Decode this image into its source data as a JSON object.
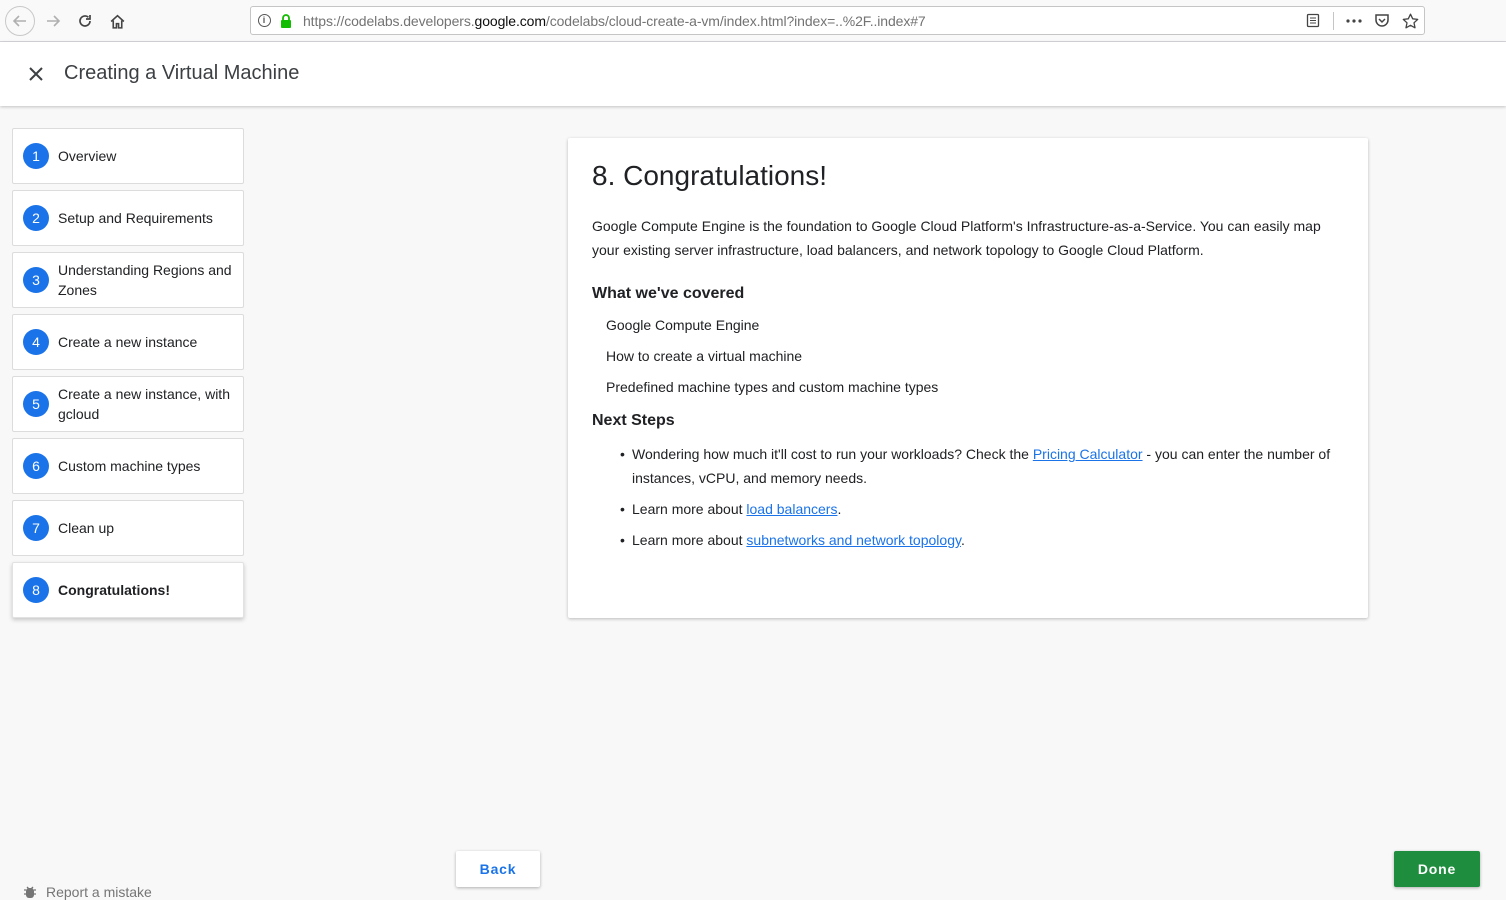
{
  "browser": {
    "url_prefix": "https://codelabs.developers.",
    "url_domain": "google.com",
    "url_suffix": "/codelabs/cloud-create-a-vm/index.html?index=..%2F..index#7",
    "icons": [
      "back-icon",
      "forward-icon",
      "reload-icon",
      "home-icon",
      "info-icon",
      "lock-icon",
      "reader-icon",
      "more-icon",
      "pocket-icon",
      "bookmark-star-icon"
    ]
  },
  "header": {
    "title": "Creating a Virtual Machine"
  },
  "steps": [
    {
      "num": "1",
      "label": "Overview"
    },
    {
      "num": "2",
      "label": "Setup and Requirements"
    },
    {
      "num": "3",
      "label": "Understanding Regions and Zones"
    },
    {
      "num": "4",
      "label": "Create a new instance"
    },
    {
      "num": "5",
      "label": "Create a new instance, with gcloud"
    },
    {
      "num": "6",
      "label": "Custom machine types"
    },
    {
      "num": "7",
      "label": "Clean up"
    },
    {
      "num": "8",
      "label": "Congratulations!"
    }
  ],
  "content": {
    "heading": "8. Congratulations!",
    "intro": "Google Compute Engine is the foundation to Google Cloud Platform's Infrastructure-as-a-Service. You can easily map your existing server infrastructure, load balancers, and network topology to Google Cloud Platform.",
    "covered_heading": "What we've covered",
    "covered": [
      "Google Compute Engine",
      "How to create a virtual machine",
      "Predefined machine types and custom machine types"
    ],
    "next_heading": "Next Steps",
    "next": {
      "item1_before": "Wondering how much it'll cost to run your workloads? Check the ",
      "item1_link": "Pricing Calculator",
      "item1_after": " - you can enter the number of instances, vCPU, and memory needs.",
      "item2_before": "Learn more about ",
      "item2_link": "load balancers",
      "item2_after": ".",
      "item3_before": "Learn more about ",
      "item3_link": "subnetworks and network topology",
      "item3_after": "."
    }
  },
  "footer": {
    "back_label": "Back",
    "done_label": "Done",
    "report_label": "Report a mistake"
  },
  "colors": {
    "accent_blue": "#1a73e8",
    "done_green": "#1e8e3e"
  }
}
